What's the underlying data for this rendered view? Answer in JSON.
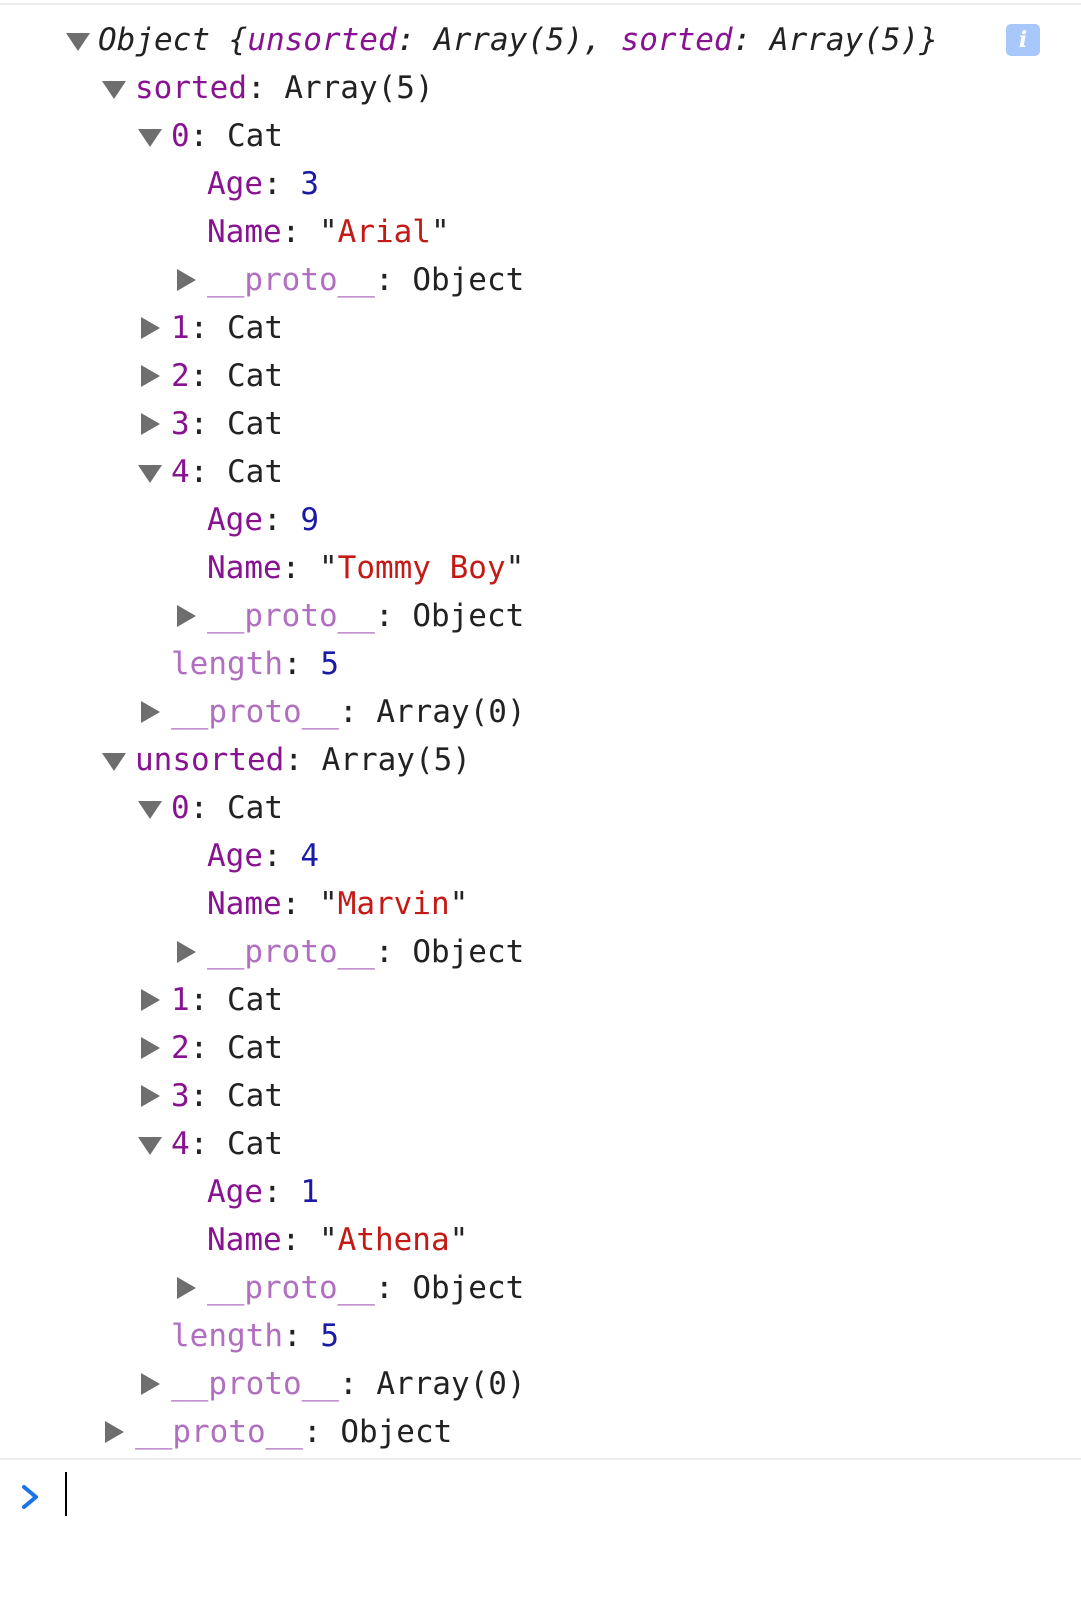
{
  "console": {
    "root": {
      "label": "Object",
      "summary_open": " {",
      "summary_key1": "unsorted",
      "summary_val1": ": Array(5), ",
      "summary_key2": "sorted",
      "summary_val2": ": Array(5)}",
      "info_badge": "i"
    },
    "sorted": {
      "key": "sorted",
      "value": "Array(5)",
      "items": [
        {
          "index": "0",
          "type": "Cat",
          "age_key": "Age",
          "age": "3",
          "name_key": "Name",
          "name": "Arial",
          "proto_key": "__proto__",
          "proto_val": "Object"
        },
        {
          "index": "1",
          "type": "Cat"
        },
        {
          "index": "2",
          "type": "Cat"
        },
        {
          "index": "3",
          "type": "Cat"
        },
        {
          "index": "4",
          "type": "Cat",
          "age_key": "Age",
          "age": "9",
          "name_key": "Name",
          "name": "Tommy Boy",
          "proto_key": "__proto__",
          "proto_val": "Object"
        }
      ],
      "length_key": "length",
      "length": "5",
      "proto_key": "__proto__",
      "proto_val": "Array(0)"
    },
    "unsorted": {
      "key": "unsorted",
      "value": "Array(5)",
      "items": [
        {
          "index": "0",
          "type": "Cat",
          "age_key": "Age",
          "age": "4",
          "name_key": "Name",
          "name": "Marvin",
          "proto_key": "__proto__",
          "proto_val": "Object"
        },
        {
          "index": "1",
          "type": "Cat"
        },
        {
          "index": "2",
          "type": "Cat"
        },
        {
          "index": "3",
          "type": "Cat"
        },
        {
          "index": "4",
          "type": "Cat",
          "age_key": "Age",
          "age": "1",
          "name_key": "Name",
          "name": "Athena",
          "proto_key": "__proto__",
          "proto_val": "Object"
        }
      ],
      "length_key": "length",
      "length": "5",
      "proto_key": "__proto__",
      "proto_val": "Array(0)"
    },
    "root_proto_key": "__proto__",
    "root_proto_val": "Object",
    "punct": {
      "colon": ": ",
      "quote": "\""
    }
  },
  "prompt": {
    "chevron_icon": "chevron-right-icon",
    "chevron_color": "#1a73e8",
    "input_value": ""
  },
  "colors": {
    "key": "#881391",
    "key_dim": "#b06fbf",
    "number": "#1a1aa6",
    "string": "#c41a16",
    "triangle": "#6e6e6e",
    "info_badge": "#a8c7fa"
  }
}
